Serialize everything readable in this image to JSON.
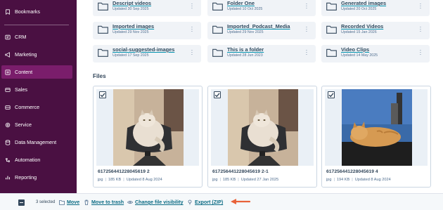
{
  "sidebar": {
    "items": [
      {
        "label": "Bookmarks",
        "icon": "bookmark-icon"
      },
      {
        "label": "CRM",
        "icon": "crm-icon"
      },
      {
        "label": "Marketing",
        "icon": "megaphone-icon"
      },
      {
        "label": "Content",
        "icon": "content-icon",
        "active": true
      },
      {
        "label": "Sales",
        "icon": "sales-icon"
      },
      {
        "label": "Commerce",
        "icon": "commerce-icon"
      },
      {
        "label": "Service",
        "icon": "service-icon"
      },
      {
        "label": "Data Management",
        "icon": "database-icon"
      },
      {
        "label": "Automation",
        "icon": "automation-icon"
      },
      {
        "label": "Reporting",
        "icon": "reporting-icon"
      }
    ]
  },
  "folders": [
    {
      "name": "Descript videos",
      "updated": "Updated 30 Sep 2025"
    },
    {
      "name": "Folder One",
      "updated": "Updated 10 Oct 2025"
    },
    {
      "name": "Generated images",
      "updated": "Updated 20 Oct 2025"
    },
    {
      "name": "Imported images",
      "updated": "Updated 29 Nov 2025"
    },
    {
      "name": "Imported_Podcast_Media",
      "updated": "Updated 29 Nov 2025"
    },
    {
      "name": "Recorded Videos",
      "updated": "Updated 15 Jan 2026"
    },
    {
      "name": "social-suggested-images",
      "updated": "Updated 17 Sep 2025"
    },
    {
      "name": "This is a folder",
      "updated": "Updated 28 Jun 2023"
    },
    {
      "name": "Video Clips",
      "updated": "Updated 14 May 2025"
    }
  ],
  "files_heading": "Files",
  "files": [
    {
      "name": "617256441228045619 2",
      "type": "jpg",
      "size": "185 KB",
      "updated": "Updated 8 Aug 2024",
      "checked": true
    },
    {
      "name": "617256441228045619 2-1",
      "type": "jpg",
      "size": "185 KB",
      "updated": "Updated 27 Jan 2025",
      "checked": true
    },
    {
      "name": "617256441228045619 4",
      "type": "jpg",
      "size": "194 KB",
      "updated": "Updated 8 Aug 2024",
      "checked": true
    }
  ],
  "bottom_bar": {
    "selected": "3 selected",
    "move": "Move",
    "move_to_trash": "Move to trash",
    "change_visibility": "Change file visibility",
    "export": "Export (ZIP)"
  },
  "colors": {
    "sidebar_bg": "#4a1042",
    "sidebar_active": "#7a1d6b",
    "link": "#0b6b84",
    "arrow": "#e8623a"
  }
}
